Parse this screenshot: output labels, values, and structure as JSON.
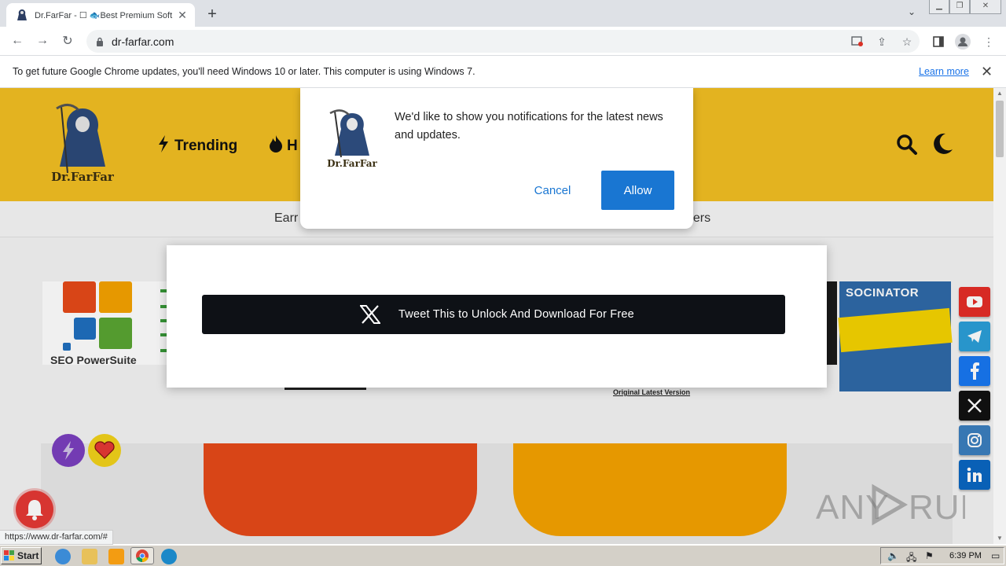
{
  "browser": {
    "tab_title": "Dr.FarFar - ☐ 🐟Best Premium Soft",
    "new_tab": "+",
    "url": "dr-farfar.com",
    "status_url": "https://www.dr-farfar.com/#"
  },
  "infobar": {
    "message": "To get future Google Chrome updates, you'll need Windows 10 or later. This computer is using Windows 7.",
    "learn_more": "Learn more"
  },
  "site": {
    "logo_text": "Dr.FarFar",
    "nav": {
      "trending": "Trending",
      "hot_partial": "H"
    },
    "subnav_left": "Earr",
    "subnav_right": "pers"
  },
  "ads": {
    "left_label": "SEO PowerSuite",
    "right_title": "SOCINATOR",
    "original_text": "Original Latest Version"
  },
  "modal": {
    "tweet_label": "Tweet This to Unlock And Download For Free"
  },
  "notification": {
    "message": "We'd like to show you notifications for the latest news and updates.",
    "cancel": "Cancel",
    "allow": "Allow"
  },
  "social": [
    "youtube-icon",
    "telegram-icon",
    "facebook-icon",
    "x-icon",
    "instagram-icon",
    "linkedin-icon"
  ],
  "colors": {
    "header_yellow": "#f2bf22",
    "allow_blue": "#1976d2",
    "youtube": "#e52d27",
    "telegram": "#2b9fd8",
    "facebook": "#1877f2",
    "x": "#111111",
    "instagram": "#3b7fbf",
    "linkedin": "#0a66c2"
  },
  "watermark": "ANY RUN",
  "taskbar": {
    "start": "Start",
    "time": "6:39 PM"
  }
}
